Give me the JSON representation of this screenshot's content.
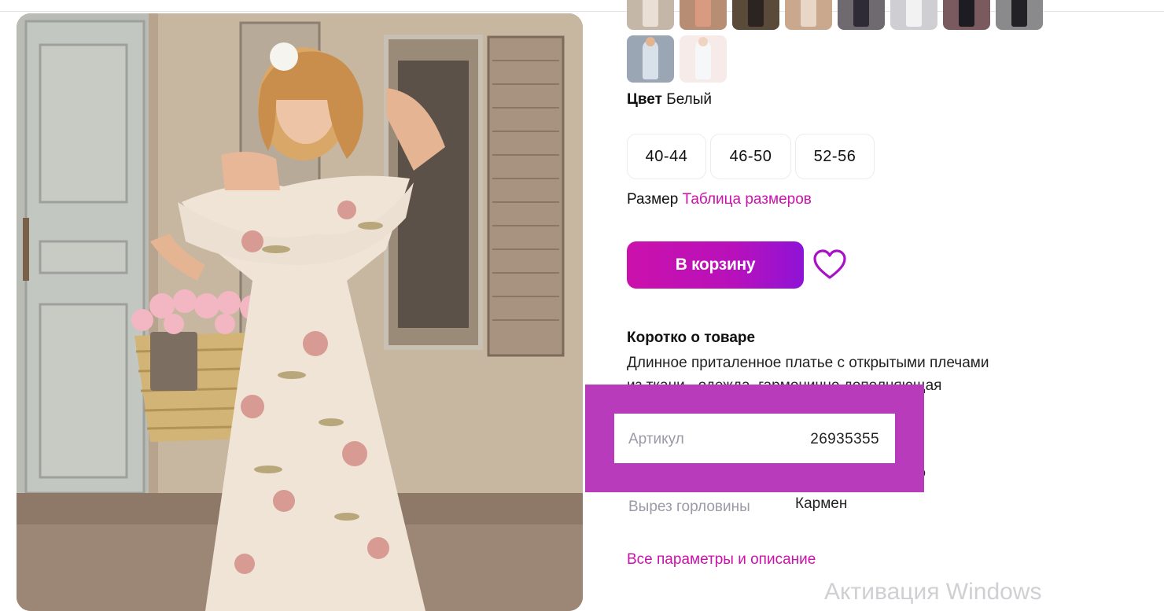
{
  "product": {
    "photo_icon": "product-photo",
    "thumbnails": [
      {
        "bg": "#c4b7a8",
        "dress": "#e9dfd4"
      },
      {
        "bg": "#b78e74",
        "dress": "#d89a80"
      },
      {
        "bg": "#5a4a3a",
        "dress": "#2b2420"
      },
      {
        "bg": "#c9a88e",
        "dress": "#e8d7c6"
      },
      {
        "bg": "#6f6a70",
        "dress": "#2e2a36"
      },
      {
        "bg": "#cfcfd3",
        "dress": "#f2f2f2"
      },
      {
        "bg": "#7b5a5f",
        "dress": "#1c1c22"
      },
      {
        "bg": "#8a8a8c",
        "dress": "#222226"
      },
      {
        "bg": "#9aa6b4",
        "dress": "#d8e0ea"
      },
      {
        "bg": "#f1dcd8",
        "dress": "#eef2f5"
      }
    ]
  },
  "color": {
    "label": "Цвет",
    "value": "Белый"
  },
  "sizes": [
    "40-44",
    "46-50",
    "52-56"
  ],
  "size_row": {
    "label": "Размер",
    "link": "Таблица размеров"
  },
  "cart_button": "В корзину",
  "favorite_icon": "heart-icon",
  "short": {
    "title": "Коротко о товаре",
    "line1": "Длинное приталенное платье с открытыми плечами",
    "line2": "из ткани - одежда, гармонично дополняющая"
  },
  "specs": {
    "hidden_suffix": "%",
    "neckline_label": "Вырез горловины",
    "neckline_value": "Кармен"
  },
  "highlight": {
    "key": "Артикул",
    "value": "26935355"
  },
  "all_params_link": "Все параметры и описание",
  "watermark": "Активация Windows",
  "colors": {
    "accent": "#cb11ab",
    "highlight": "#b83bbc",
    "muted": "#9a9aa8"
  }
}
